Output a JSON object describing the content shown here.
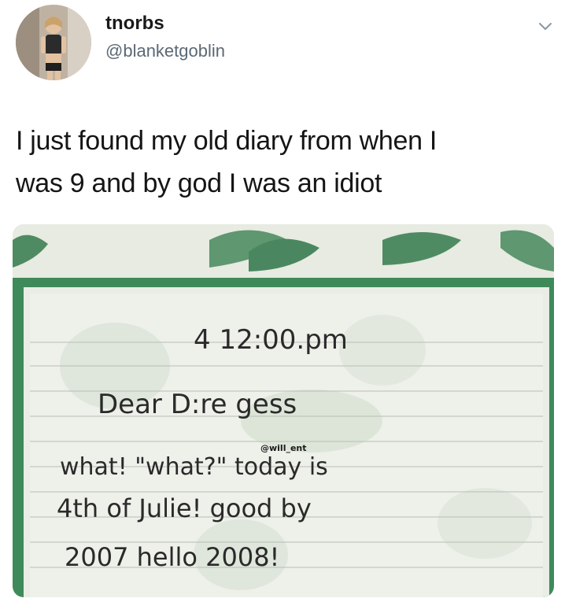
{
  "tweet": {
    "display_name": "tnorbs",
    "handle": "@blanketgoblin",
    "text_line1": "I just found my old diary from when I",
    "text_line2": "was 9 and by god I was an idiot",
    "menu_icon": "chevron-down-icon",
    "avatar_icon": "profile-photo"
  },
  "diary_photo": {
    "watermark": "@will_ent",
    "handwriting": {
      "time_line": "4 12:00.pm",
      "line1": "Dear D:re gess",
      "line2": "what! \"what?\" today is",
      "line3": "4th of Julie! good by",
      "line4": "2007 hello 2008!"
    },
    "colors": {
      "border_green": "#3f8a5a",
      "paper": "#eef0ea",
      "leaf_green": "#7fa88a"
    }
  }
}
